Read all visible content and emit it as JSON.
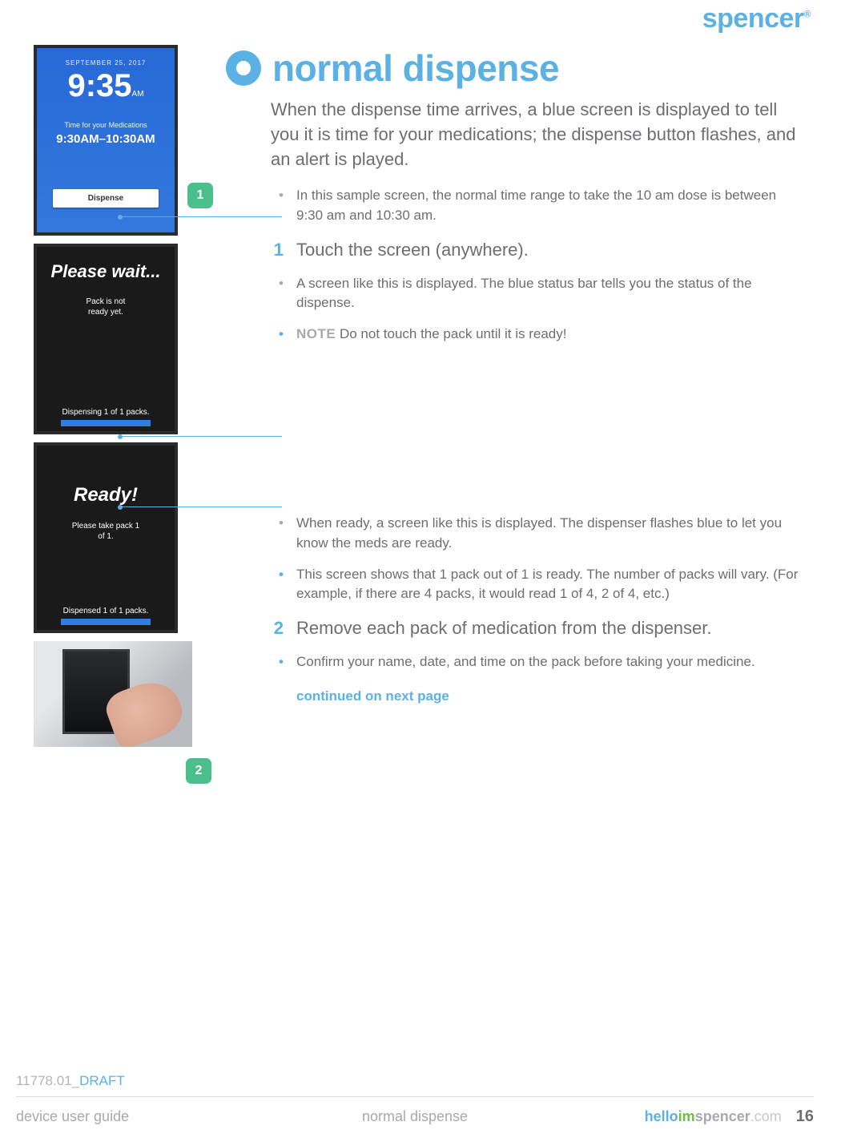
{
  "brand": "spencer",
  "brand_mark": "®",
  "title": "normal dispense",
  "intro": "When the dispense time arrives, a blue screen is displayed to tell you it is time for your medications; the dispense button flashes, and an alert is played.",
  "callouts": {
    "one": "1",
    "two": "2"
  },
  "screens": {
    "s1": {
      "date": "SEPTEMBER 25, 2017",
      "time": "9:35",
      "ampm": "AM",
      "sub": "Time for your Medications",
      "range": "9:30AM–10:30AM",
      "button": "Dispense"
    },
    "s2": {
      "title": "Please wait...",
      "msg_l1": "Pack is not",
      "msg_l2": "ready yet.",
      "status": "Dispensing 1 of 1 packs."
    },
    "s3": {
      "title": "Ready!",
      "msg_l1": "Please take pack 1",
      "msg_l2": "of 1.",
      "status": "Dispensed 1 of 1 packs."
    }
  },
  "block1": [
    {
      "marker": "bullet",
      "size": "sm",
      "text": "In this sample screen, the normal time range to take the 10 am dose is between 9:30 am and 10:30 am."
    },
    {
      "marker": "num",
      "num": "1",
      "size": "big",
      "text": "Touch the screen (anywhere)."
    },
    {
      "marker": "bullet",
      "size": "sm",
      "text": "A screen like this is displayed. The blue status bar tells you the status of the dispense."
    },
    {
      "marker": "dot",
      "size": "sm",
      "note": "NOTE",
      "text": "  Do not touch the pack until it is ready!"
    }
  ],
  "block2": [
    {
      "marker": "bullet",
      "size": "sm",
      "text": "When ready, a screen like this is displayed. The dispenser flashes blue to let you know the meds are ready."
    },
    {
      "marker": "dot",
      "size": "sm",
      "text": "This screen shows that 1 pack out of 1 is ready. The number of packs will vary. (For example, if there are 4 packs, it would read 1 of 4, 2 of 4, etc.)"
    },
    {
      "marker": "num",
      "num": "2",
      "size": "big",
      "text": "Remove each pack of medication from the dispenser."
    },
    {
      "marker": "dot",
      "size": "sm",
      "text": "Confirm your name, date, and time on the pack before taking your medicine."
    }
  ],
  "continued": "continued on next page",
  "doc_id_prefix": "11778.01_",
  "doc_id_suffix": "DRAFT",
  "footer": {
    "left": "device user guide",
    "center": "normal dispense",
    "url_hello": "hello",
    "url_im": "im",
    "url_spencer": "spencer",
    "url_com": ".com",
    "page": "16"
  }
}
